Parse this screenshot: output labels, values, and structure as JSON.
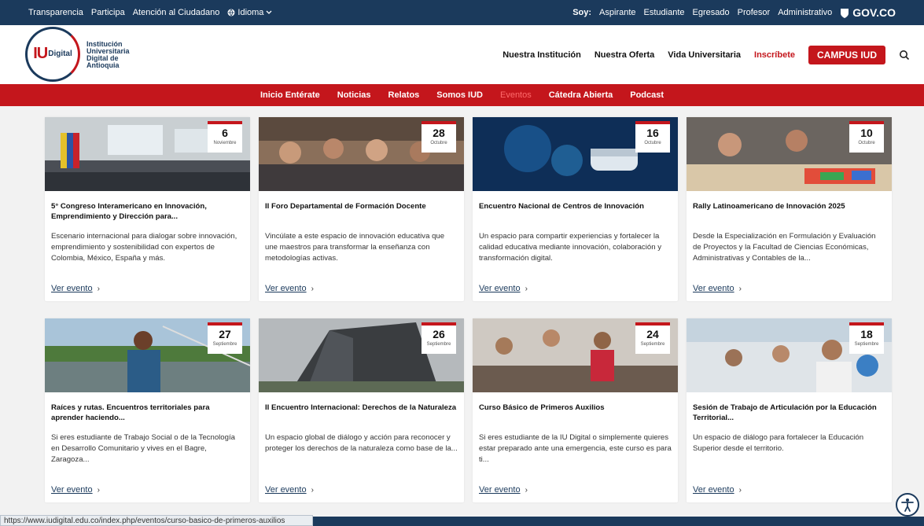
{
  "topbar": {
    "links": [
      "Transparencia",
      "Participa",
      "Atención al Ciudadano"
    ],
    "language": "Idioma",
    "soy_label": "Soy:",
    "profiles": [
      "Aspirante",
      "Estudiante",
      "Egresado",
      "Profesor",
      "Administrativo"
    ],
    "govco": "GOV.CO"
  },
  "logo": {
    "iu": "IU",
    "digital": "Digital",
    "name": "Institución Universitaria Digital de Antioquia"
  },
  "nav": {
    "items": [
      "Nuestra Institución",
      "Nuestra Oferta",
      "Vida Universitaria"
    ],
    "inscribete": "Inscríbete",
    "campus": "CAMPUS IUD"
  },
  "subnav": {
    "items": [
      "Inicio Entérate",
      "Noticias",
      "Relatos",
      "Somos IUD",
      "Eventos",
      "Cátedra Abierta",
      "Podcast"
    ],
    "active_index": 4
  },
  "cards": [
    {
      "day": "6",
      "month": "Noviembre",
      "title": "5° Congreso Interamericano en Innovación, Emprendimiento y Dirección para...",
      "desc": "Escenario internacional para dialogar sobre innovación, emprendimiento y sostenibilidad con expertos de Colombia, México, España y más.",
      "link": "Ver evento"
    },
    {
      "day": "28",
      "month": "Octubre",
      "title": "II Foro Departamental de Formación Docente",
      "desc": "Vincúlate a este espacio de innovación educativa que une maestros para transformar la enseñanza con metodologías activas.",
      "link": "Ver evento"
    },
    {
      "day": "16",
      "month": "Octubre",
      "title": "Encuentro Nacional de Centros de Innovación",
      "desc": "Un espacio para compartir experiencias y fortalecer la calidad educativa mediante innovación, colaboración y transformación digital.",
      "link": "Ver evento"
    },
    {
      "day": "10",
      "month": "Octubre",
      "title": "Rally Latinoamericano de Innovación 2025",
      "desc": "Desde la Especialización en Formulación y Evaluación de Proyectos y la Facultad de Ciencias Económicas, Administrativas y Contables de la...",
      "link": "Ver evento"
    },
    {
      "day": "27",
      "month": "Septiembre",
      "title": "Raíces y rutas. Encuentros territoriales para aprender haciendo...",
      "desc": "Si eres estudiante de Trabajo Social o de la Tecnología en Desarrollo Comunitario y vives en el Bagre, Zaragoza...",
      "link": "Ver evento"
    },
    {
      "day": "26",
      "month": "Septiembre",
      "title": "II Encuentro Internacional: Derechos de la Naturaleza",
      "desc": "Un espacio global de diálogo y acción para reconocer y proteger los derechos de la naturaleza como base de la...",
      "link": "Ver evento"
    },
    {
      "day": "24",
      "month": "Septiembre",
      "title": "Curso Básico de Primeros Auxilios",
      "desc": "Si eres estudiante de la IU Digital o simplemente quieres estar preparado ante una emergencia, este curso es para ti...",
      "link": "Ver evento"
    },
    {
      "day": "18",
      "month": "Septiembre",
      "title": "Sesión de Trabajo de Articulación por la Educación Territorial...",
      "desc": "Un espacio de diálogo para fortalecer la Educación Superior desde el territorio.",
      "link": "Ver evento"
    }
  ],
  "status_url": "https://www.iudigital.edu.co/index.php/eventos/curso-basico-de-primeros-auxilios",
  "colors": {
    "primary": "#1b3a5c",
    "accent": "#c4161c"
  }
}
